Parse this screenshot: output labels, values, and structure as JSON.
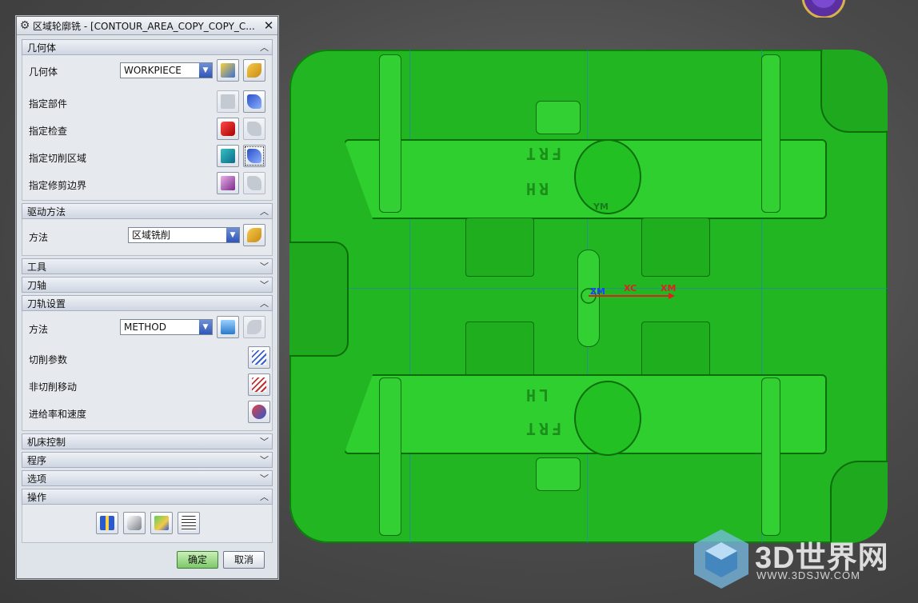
{
  "dialog": {
    "title": "区域轮廓铣 - [CONTOUR_AREA_COPY_COPY_C...",
    "close_label": "✕",
    "sections": {
      "geometry": {
        "header": "几何体",
        "geometry_label": "几何体",
        "geometry_value": "WORKPIECE",
        "part_label": "指定部件",
        "check_label": "指定检查",
        "cut_area_label": "指定切削区域",
        "trim_label": "指定修剪边界"
      },
      "drive": {
        "header": "驱动方法",
        "method_label": "方法",
        "method_value": "区域铣削"
      },
      "tool": {
        "header": "工具"
      },
      "axis": {
        "header": "刀轴"
      },
      "path": {
        "header": "刀轨设置",
        "method_label": "方法",
        "method_value": "METHOD",
        "cut_params_label": "切削参数",
        "non_cut_label": "非切削移动",
        "feeds_label": "进给率和速度"
      },
      "machine": {
        "header": "机床控制"
      },
      "program": {
        "header": "程序"
      },
      "options": {
        "header": "选项"
      },
      "actions": {
        "header": "操作"
      }
    },
    "ok_label": "确定",
    "cancel_label": "取消"
  },
  "viewport": {
    "engrave_top_1": "FRT",
    "engrave_top_2": "RH",
    "engrave_bottom_1": "LH",
    "engrave_bottom_2": "FRT",
    "axis_ym": "YM",
    "axis_xc": "XC",
    "axis_xm": "XM",
    "axis_zm": "ZM",
    "model_color": "#22b722"
  },
  "watermark": {
    "brand": "3D世界网",
    "url": "WWW.3DSJW.COM"
  }
}
